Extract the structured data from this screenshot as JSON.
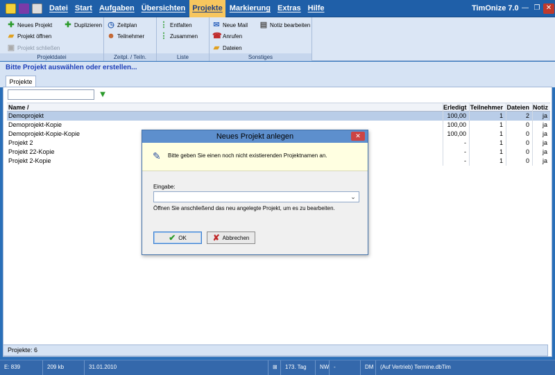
{
  "app": {
    "title": "TimOnize 7.0"
  },
  "menu": [
    "Datei",
    "Start",
    "Aufgaben",
    "Übersichten",
    "Projekte",
    "Markierung",
    "Extras",
    "Hilfe"
  ],
  "active_menu": "Projekte",
  "ribbon": {
    "projektdatei": {
      "label": "Projektdatei",
      "neues_projekt": "Neues Projekt",
      "duplizieren": "Duplizieren",
      "projekt_oeffnen": "Projekt öffnen",
      "projekt_schliessen": "Projekt schließen"
    },
    "zeitpl": {
      "label": "Zeitpl. / Teiln.",
      "zeitplan": "Zeitplan",
      "teilnehmer": "Teilnehmer"
    },
    "liste": {
      "label": "Liste",
      "entfalten": "Entfalten",
      "zusammen": "Zusammen"
    },
    "sonstiges": {
      "label": "Sonstiges",
      "neue_mail": "Neue Mail",
      "anrufen": "Anrufen",
      "dateien": "Dateien",
      "notiz_bearbeiten": "Notiz bearbeiten"
    }
  },
  "prompt": "Bitte Projekt auswählen oder erstellen...",
  "tab": "Projekte",
  "grid": {
    "headers": {
      "name": "Name",
      "erledigt": "Erledigt",
      "teilnehmer": "Teilnehmer",
      "dateien": "Dateien",
      "notiz": "Notiz"
    },
    "rows": [
      {
        "name": "Demoprojekt",
        "erledigt": "100,00",
        "teilnehmer": "1",
        "dateien": "2",
        "notiz": "ja"
      },
      {
        "name": "Demoprojekt-Kopie",
        "erledigt": "100,00",
        "teilnehmer": "1",
        "dateien": "0",
        "notiz": "ja"
      },
      {
        "name": "Demoprojekt-Kopie-Kopie",
        "erledigt": "100,00",
        "teilnehmer": "1",
        "dateien": "0",
        "notiz": "ja"
      },
      {
        "name": "Projekt 2",
        "erledigt": "-",
        "teilnehmer": "1",
        "dateien": "0",
        "notiz": "ja"
      },
      {
        "name": "Projekt 22-Kopie",
        "erledigt": "-",
        "teilnehmer": "1",
        "dateien": "0",
        "notiz": "ja"
      },
      {
        "name": "Projekt 2-Kopie",
        "erledigt": "-",
        "teilnehmer": "1",
        "dateien": "0",
        "notiz": "ja"
      }
    ]
  },
  "footer": {
    "count": "Projekte: 6"
  },
  "status": {
    "e": "E: 839",
    "size": "209 kb",
    "date": "31.01.2010",
    "tag": "173. Tag",
    "nw": "NW",
    "dash": "-",
    "dm": "DM",
    "file": "(Auf Vertrieb) Termine.dbTim"
  },
  "dialog": {
    "title": "Neues Projekt anlegen",
    "message": "Bitte geben Sie einen noch nicht existierenden Projektnamen an.",
    "eingabe_label": "Eingabe:",
    "eingabe_value": "",
    "hint": "Öffnen Sie anschließend das neu angelegte Projekt, um es zu bearbeiten.",
    "ok": "OK",
    "cancel": "Abbrechen"
  },
  "colors": {
    "accent": "#1f5fa8",
    "active_menu": "#f7c65e",
    "selected_row": "#b9cde8",
    "prompt_text": "#1e3fb8"
  }
}
